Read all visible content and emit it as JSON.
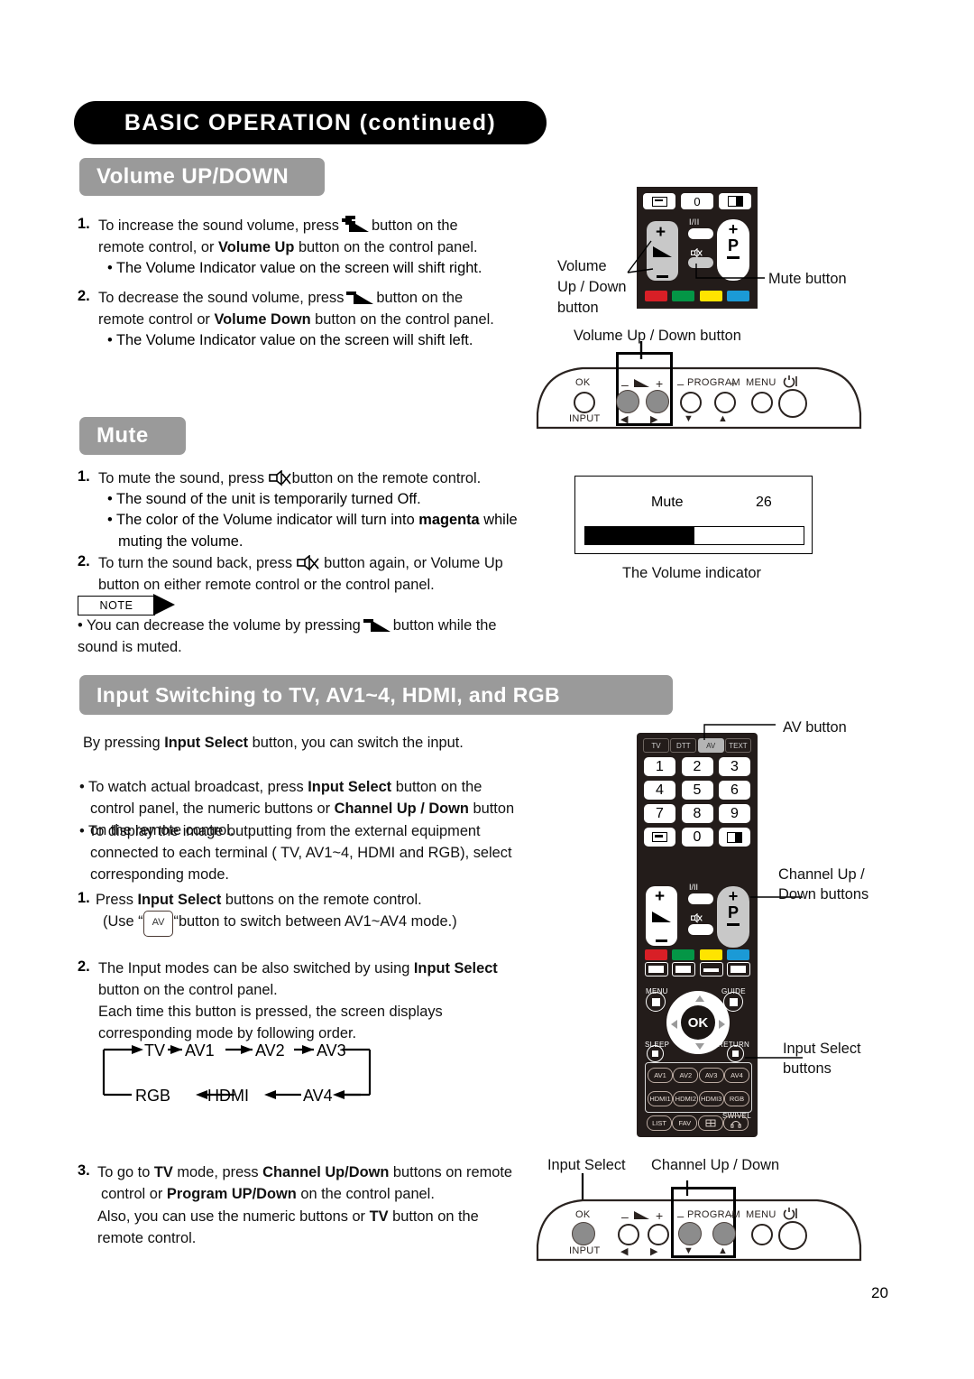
{
  "chapter": {
    "title": "BASIC OPERATION (continued)"
  },
  "page_number": "20",
  "sections": {
    "volume": {
      "heading": "Volume UP/DOWN",
      "step1_num": "1.",
      "step1_a": "To increase the sound volume, press",
      "step1_b": "button on the",
      "step1_line2_a": "remote control, or ",
      "step1_line2_bold": "Volume Up",
      "step1_line2_b": " button on the control panel.",
      "step1_bullet": "• The Volume Indicator value on the screen will shift right.",
      "step2_num": "2.",
      "step2_a": "To decrease the sound volume, press",
      "step2_b": "button on the",
      "step2_line2_a": "remote control or ",
      "step2_line2_bold": "Volume Down",
      "step2_line2_b": " button on the control panel.",
      "step2_bullet": "• The Volume Indicator value on the screen will shift left."
    },
    "mute": {
      "heading": "Mute",
      "step1_num": "1.",
      "step1_a": "To mute the sound, press",
      "step1_b": "button on the remote control.",
      "bullet1": "• The sound of the unit is temporarily turned Off.",
      "bullet2_a": "• The color of the Volume indicator will turn into ",
      "bullet2_bold": "magenta",
      "bullet2_b": " while",
      "bullet2_line2": "muting the volume.",
      "step2_num": "2.",
      "step2_a": "To turn the sound back, press",
      "step2_b": "button again, or Volume Up",
      "step2_line2": "button on either remote control or the control panel.",
      "note_label": "NOTE",
      "note_a": "• You can decrease the volume by pressing",
      "note_b": "button while the",
      "note_line2": "sound is muted."
    },
    "input": {
      "heading": "Input Switching to TV, AV1~4, HDMI, and RGB",
      "intro_a": "By pressing ",
      "intro_bold": "Input Select",
      "intro_b": " button, you can switch the input.",
      "b1_l1_a": "• To watch actual broadcast, press ",
      "b1_l1_bold": "Input Select",
      "b1_l1_b": " button on the",
      "b1_l2_a": "control panel, the numeric buttons or ",
      "b1_l2_bold": "Channel Up / Down",
      "b1_l2_b": " button",
      "b1_l3": "on the remote control.",
      "b2_l1": "• To display the image outputting from the external equipment",
      "b2_l2": "connected to each terminal ( TV, AV1~4, HDMI and RGB), select",
      "b2_l3": "corresponding mode.",
      "s1_num": "1.",
      "s1_a": "Press ",
      "s1_bold": "Input Select",
      "s1_b": " buttons on the remote control.",
      "s1_use_a": "(Use “",
      "s1_use_key": "AV",
      "s1_use_b": "“button to switch between AV1~AV4 mode.)",
      "s2_num": "2.",
      "s2_l1_a": "The Input modes can be also switched by using ",
      "s2_l1_bold": "Input Select",
      "s2_l2": "button on the control panel.",
      "s2_l3": "Each time this button is pressed, the screen displays",
      "s2_l4": "corresponding mode by following order.",
      "s3_num": "3.",
      "s3_l1_a": "To go to ",
      "s3_l1_b1": "TV",
      "s3_l1_b": " mode, press ",
      "s3_l1_b2": "Channel Up/Down",
      "s3_l1_c": " buttons on remote",
      "s3_l2_a": "control or ",
      "s3_l2_bold": "Program UP/Down",
      "s3_l2_b": " on the control panel.",
      "s3_l3_a": "Also, you can use the numeric buttons or ",
      "s3_l3_bold": "TV",
      "s3_l3_b": " button on the",
      "s3_l4": "remote control."
    }
  },
  "cycle_diagram": {
    "top": [
      "TV",
      "AV1",
      "AV2",
      "AV3"
    ],
    "bottom": [
      "RGB",
      "HDMI",
      "AV4"
    ]
  },
  "callouts": {
    "volume_up_down_button_multiline": "Volume\nUp / Down\nbutton",
    "volume_up_down_l1": "Volume",
    "volume_up_down_l2": "Up / Down",
    "volume_up_down_l3": "button",
    "mute_button": "Mute button",
    "volume_up_down_button": "Volume Up / Down button",
    "volume_indicator": "The Volume indicator",
    "av_button": "AV button",
    "channel_up_l1": "Channel Up /",
    "channel_up_l2": "Down buttons",
    "input_select_l1": "Input Select",
    "input_select_l2": "buttons",
    "input_select_bottom": "Input Select",
    "channel_up_down_bottom": "Channel Up / Down"
  },
  "volume_indicator": {
    "label": "Mute",
    "value": "26",
    "fill_percent": 50
  },
  "remote_small": {
    "row1": [
      "wide-icon",
      "0",
      "picture-icon"
    ],
    "iii_label": "I/II",
    "p_plus": "+",
    "p_letter": "P",
    "color_keys": [
      "#d81f26",
      "#049646",
      "#ffe400",
      "#1b9ad6"
    ]
  },
  "remote_large": {
    "source_keys": [
      "TV",
      "DTT",
      "AV",
      "TEXT"
    ],
    "selected_source": "AV",
    "numpad": [
      [
        "1",
        "2",
        "3"
      ],
      [
        "4",
        "5",
        "6"
      ],
      [
        "7",
        "8",
        "9"
      ]
    ],
    "numpad_last": [
      "wide-icon",
      "0",
      "picture-icon"
    ],
    "iii_label": "I/II",
    "p_letter": "P",
    "menu_label": "MENU",
    "guide_label": "GUIDE",
    "ok_label": "OK",
    "sleep_label": "SLEEP",
    "return_label": "RETURN",
    "av_keys": [
      "AV1",
      "AV2",
      "AV3",
      "AV4"
    ],
    "hdmi_keys": [
      "HDMI1",
      "HDMI2",
      "HDMI3",
      "RGB"
    ],
    "swivel_label": "SWIVEL",
    "bottom_keys": [
      "LIST",
      "FAV",
      "grid-icon",
      "headphone-icon"
    ],
    "color_keys": [
      "#d81f26",
      "#049646",
      "#ffe400",
      "#1b9ad6"
    ]
  },
  "control_panel": {
    "ok_label": "OK",
    "input_label": "INPUT",
    "minus": "–",
    "plus": "+",
    "program_label": "PROGRAM",
    "menu_label": "MENU",
    "left_arrow": "◀",
    "right_arrow": "▶",
    "down_arrow": "▼",
    "up_arrow": "▲"
  },
  "colors": {
    "header_black": "#000000",
    "section_gray": "#9a9a9a",
    "remote_body": "#231c1a",
    "key_gray": "#c8c8c8"
  }
}
